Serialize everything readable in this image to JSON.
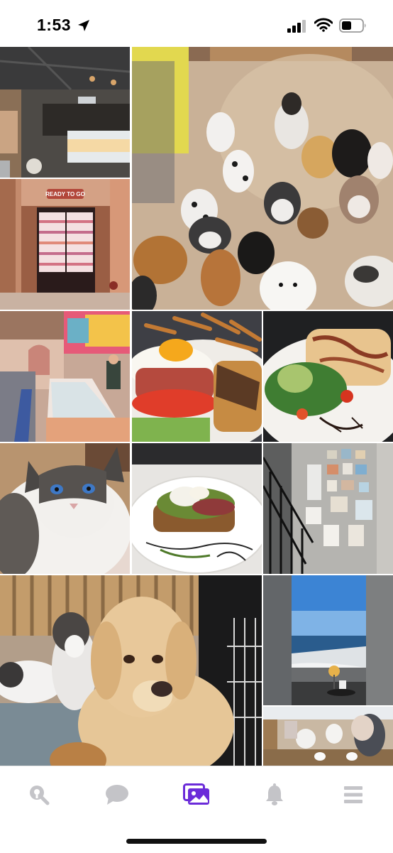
{
  "status": {
    "time": "1:53"
  },
  "tiles": {
    "cafe_interior": "cafe-interior",
    "ready_to_go": {
      "sign": "READY TO GO"
    },
    "dog_group": "dog-group",
    "cafe_counter": "cafe-counter",
    "brunch_plate": "brunch-plate",
    "salad_plate": "salad-plate",
    "cat": "ragdoll-cat",
    "avocado_toast": "avocado-toast",
    "art_wall": "art-wall",
    "golden_dog": "golden-retriever",
    "sea_view": "sea-view-window",
    "cats_room": "cat-room"
  },
  "tabbar": {
    "active_tab": "photos",
    "accent_color": "#6b2bd9",
    "inactive_color": "#c4c4c8",
    "tabs": [
      {
        "icon": "search-location-icon"
      },
      {
        "icon": "chat-bubble-icon"
      },
      {
        "icon": "photos-icon"
      },
      {
        "icon": "bell-icon"
      },
      {
        "icon": "menu-icon"
      }
    ]
  }
}
